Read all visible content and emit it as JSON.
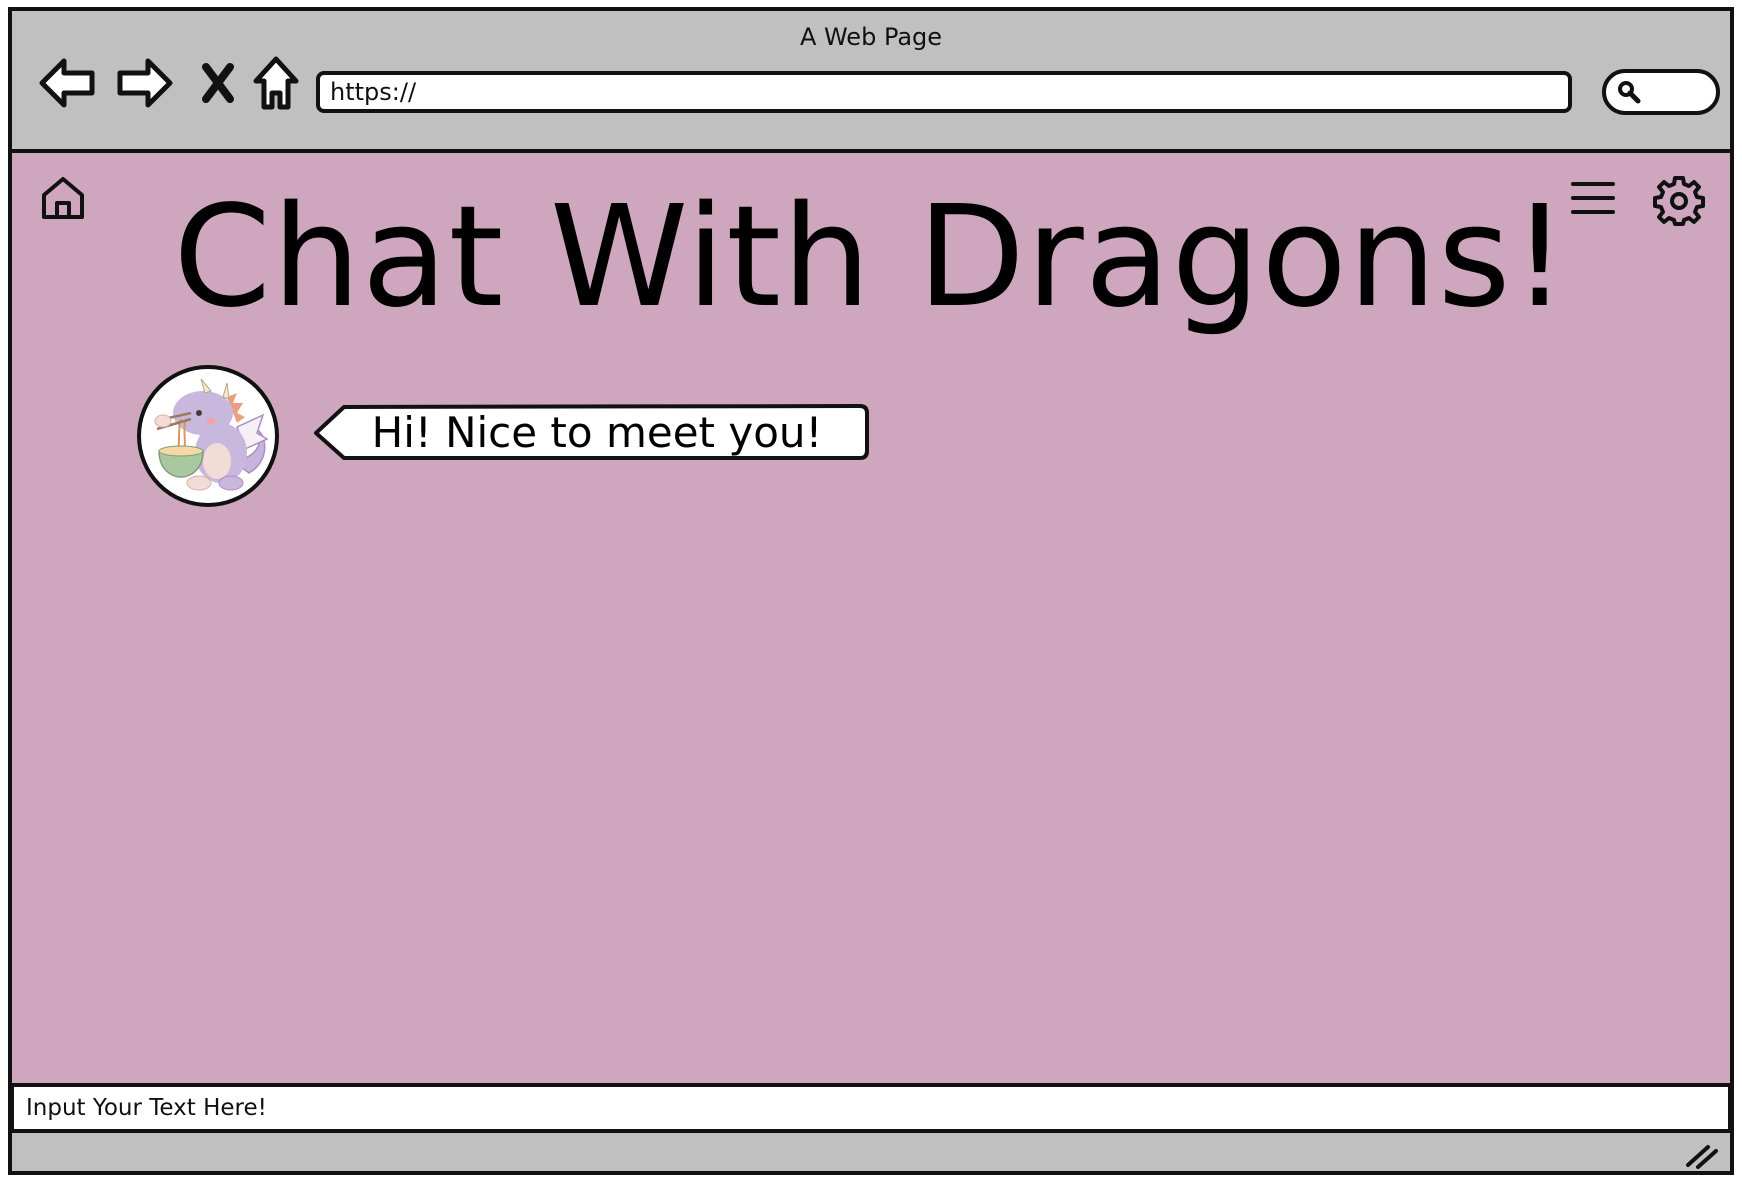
{
  "window": {
    "title": "A Web Page"
  },
  "browser": {
    "back_icon": "back-arrow-icon",
    "forward_icon": "forward-arrow-icon",
    "stop_icon": "close-icon",
    "home_icon": "home-icon",
    "url": "https://",
    "search_icon": "search-icon"
  },
  "header": {
    "title": "Chat With Dragons!",
    "home_icon": "home-icon",
    "menu_icon": "hamburger-menu-icon",
    "settings_icon": "gear-icon"
  },
  "chat": {
    "messages": [
      {
        "sender": "dragon",
        "text": "Hi! Nice to meet you!"
      }
    ]
  },
  "composer": {
    "placeholder": "Input Your Text Here!"
  },
  "colors": {
    "content_background": "#cea7be",
    "chrome_background": "#c0c0c0",
    "outline": "#111111"
  }
}
